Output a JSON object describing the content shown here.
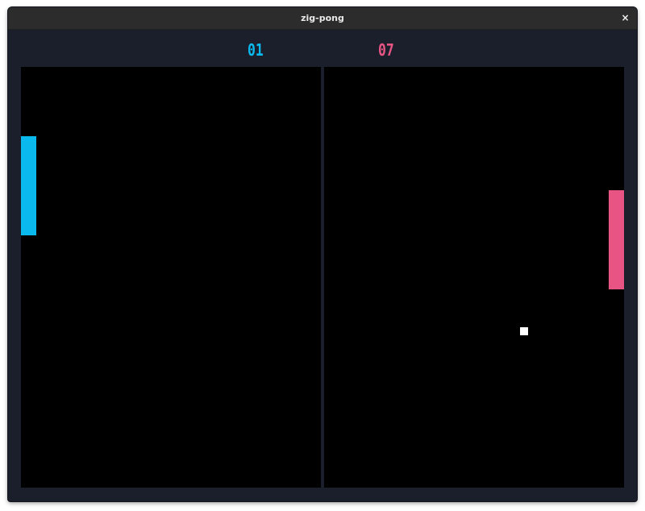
{
  "window": {
    "title": "zig-pong",
    "close_glyph": "×"
  },
  "scores": {
    "left": "01",
    "right": "07"
  },
  "colors": {
    "left_player": "#0abaef",
    "right_player": "#e85585",
    "court": "#000000",
    "background": "#1b1f2b",
    "ball": "#ffffff"
  },
  "icons": {
    "close": "close-icon"
  }
}
